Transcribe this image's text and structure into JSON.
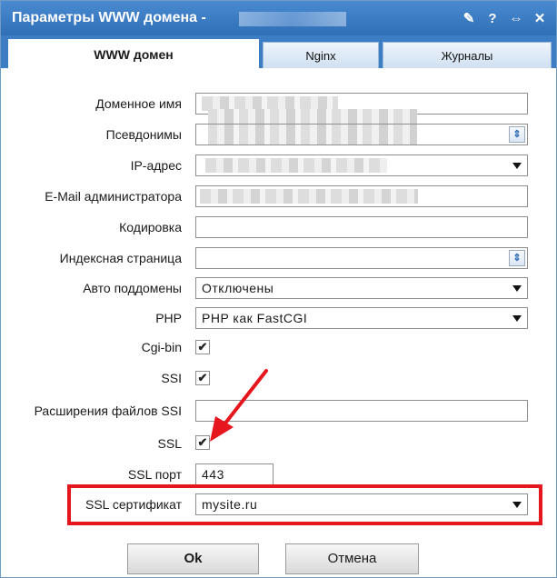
{
  "window": {
    "title": "Параметры WWW домена -",
    "icons": [
      "brush-icon",
      "help-icon",
      "resize-icon",
      "close-icon"
    ],
    "icon_glyphs": [
      "✎",
      "?",
      "⇔",
      "✕"
    ]
  },
  "tabs": [
    {
      "label": "WWW домен",
      "active": true
    },
    {
      "label": "Nginx",
      "active": false
    },
    {
      "label": "Журналы",
      "active": false
    }
  ],
  "form": {
    "domain_label": "Доменное имя",
    "aliases_label": "Псевдонимы",
    "ip_label": "IP-адрес",
    "email_label": "E-Mail администратора",
    "encoding_label": "Кодировка",
    "index_label": "Индексная страница",
    "autosub_label": "Авто поддомены",
    "autosub_value": "Отключены",
    "php_label": "PHP",
    "php_value": "PHP как FastCGI",
    "cgi_label": "Cgi-bin",
    "cgi_checked": "✔",
    "ssi_label": "SSI",
    "ssi_checked": "✔",
    "ssi_ext_label": "Расширения файлов SSI",
    "ssl_label": "SSL",
    "ssl_checked": "✔",
    "ssl_port_label": "SSL порт",
    "ssl_port_value": "443",
    "ssl_cert_label": "SSL сертификат",
    "ssl_cert_value": "mysite.ru"
  },
  "buttons": {
    "ok": "Ok",
    "cancel": "Отмена"
  },
  "colors": {
    "titlebar": "#2f6fb6",
    "highlight": "#e5161d",
    "arrow": "#e5161d"
  }
}
